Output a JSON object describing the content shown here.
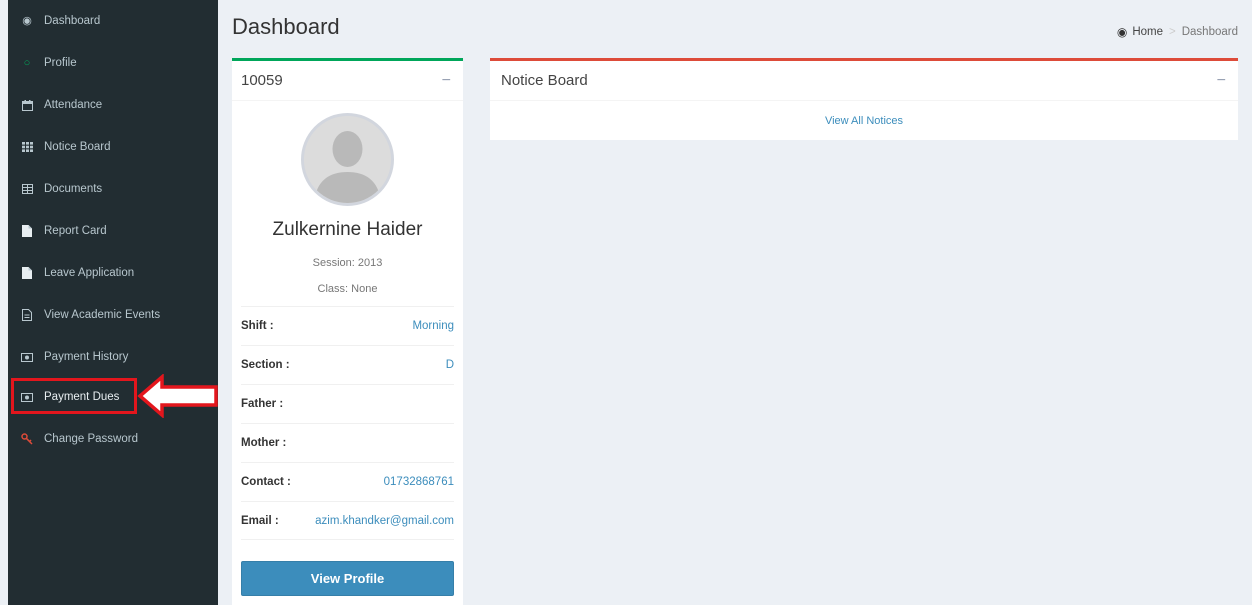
{
  "sidebar": {
    "items": [
      {
        "label": "Dashboard",
        "icon": "dashboard-icon"
      },
      {
        "label": "Profile",
        "icon": "circle-icon"
      },
      {
        "label": "Attendance",
        "icon": "calendar-icon"
      },
      {
        "label": "Notice Board",
        "icon": "grid-icon"
      },
      {
        "label": "Documents",
        "icon": "table-icon"
      },
      {
        "label": "Report Card",
        "icon": "file-icon"
      },
      {
        "label": "Leave Application",
        "icon": "file-icon"
      },
      {
        "label": "View Academic Events",
        "icon": "document-icon"
      },
      {
        "label": "Payment History",
        "icon": "money-icon"
      },
      {
        "label": "Payment Dues",
        "icon": "money-icon"
      },
      {
        "label": "Change Password",
        "icon": "key-icon"
      }
    ]
  },
  "header": {
    "title": "Dashboard",
    "breadcrumb": {
      "home": "Home",
      "current": "Dashboard"
    }
  },
  "profile": {
    "id": "10059",
    "name": "Zulkernine Haider",
    "session": "Session: 2013",
    "class": "Class: None",
    "fields": [
      {
        "label": "Shift :",
        "value": "Morning"
      },
      {
        "label": "Section :",
        "value": "D"
      },
      {
        "label": "Father :",
        "value": ""
      },
      {
        "label": "Mother :",
        "value": ""
      },
      {
        "label": "Contact :",
        "value": "01732868761"
      },
      {
        "label": "Email :",
        "value": "azim.khandker@gmail.com"
      }
    ],
    "button_label": "View Profile",
    "collapse_symbol": "−"
  },
  "notice_board": {
    "title": "Notice Board",
    "link": "View All Notices",
    "collapse_symbol": "−"
  },
  "colors": {
    "sidebar_bg": "#222d32",
    "primary": "#3c8dbc",
    "success": "#00a65a",
    "danger": "#dd4b39",
    "highlight_annotation": "#e3161d"
  }
}
